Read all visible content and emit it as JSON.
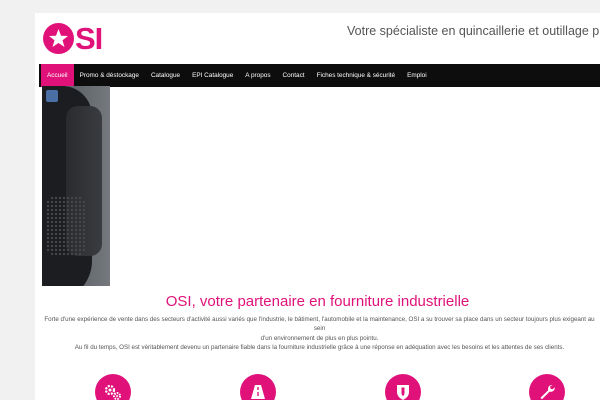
{
  "header": {
    "logo_text": "SI",
    "tagline": "Votre spécialiste en quincaillerie et outillage professionnel"
  },
  "nav": {
    "items": [
      {
        "label": "Accueil",
        "active": true
      },
      {
        "label": "Promo & déstockage"
      },
      {
        "label": "Catalogue"
      },
      {
        "label": "EPI Catalogue"
      },
      {
        "label": "A propos"
      },
      {
        "label": "Contact"
      },
      {
        "label": "Fiches technique & sécurité"
      },
      {
        "label": "Emploi"
      }
    ]
  },
  "main": {
    "headline": "OSI, votre partenaire en fourniture industrielle",
    "intro_line1": "Forte d'une expérience de vente dans des secteurs d'activité aussi variés que l'industrie, le bâtiment, l'automobile et la maintenance, OSI a su trouver sa place dans un secteur toujours plus exigeant au sein",
    "intro_line2": "d'un environnement de plus en plus pointu.",
    "intro_line3": "Au fil du temps, OSI est véritablement devenu un partenaire fiable dans la fourniture industrielle grâce à une réponse en adéquation avec les besoins et les attentes de ses clients."
  },
  "feature_icons": [
    "gears-icon",
    "road-icon",
    "shield-icon",
    "wrench-icon"
  ],
  "colors": {
    "brand": "#e0127a",
    "navbar": "#0d0d0d"
  }
}
